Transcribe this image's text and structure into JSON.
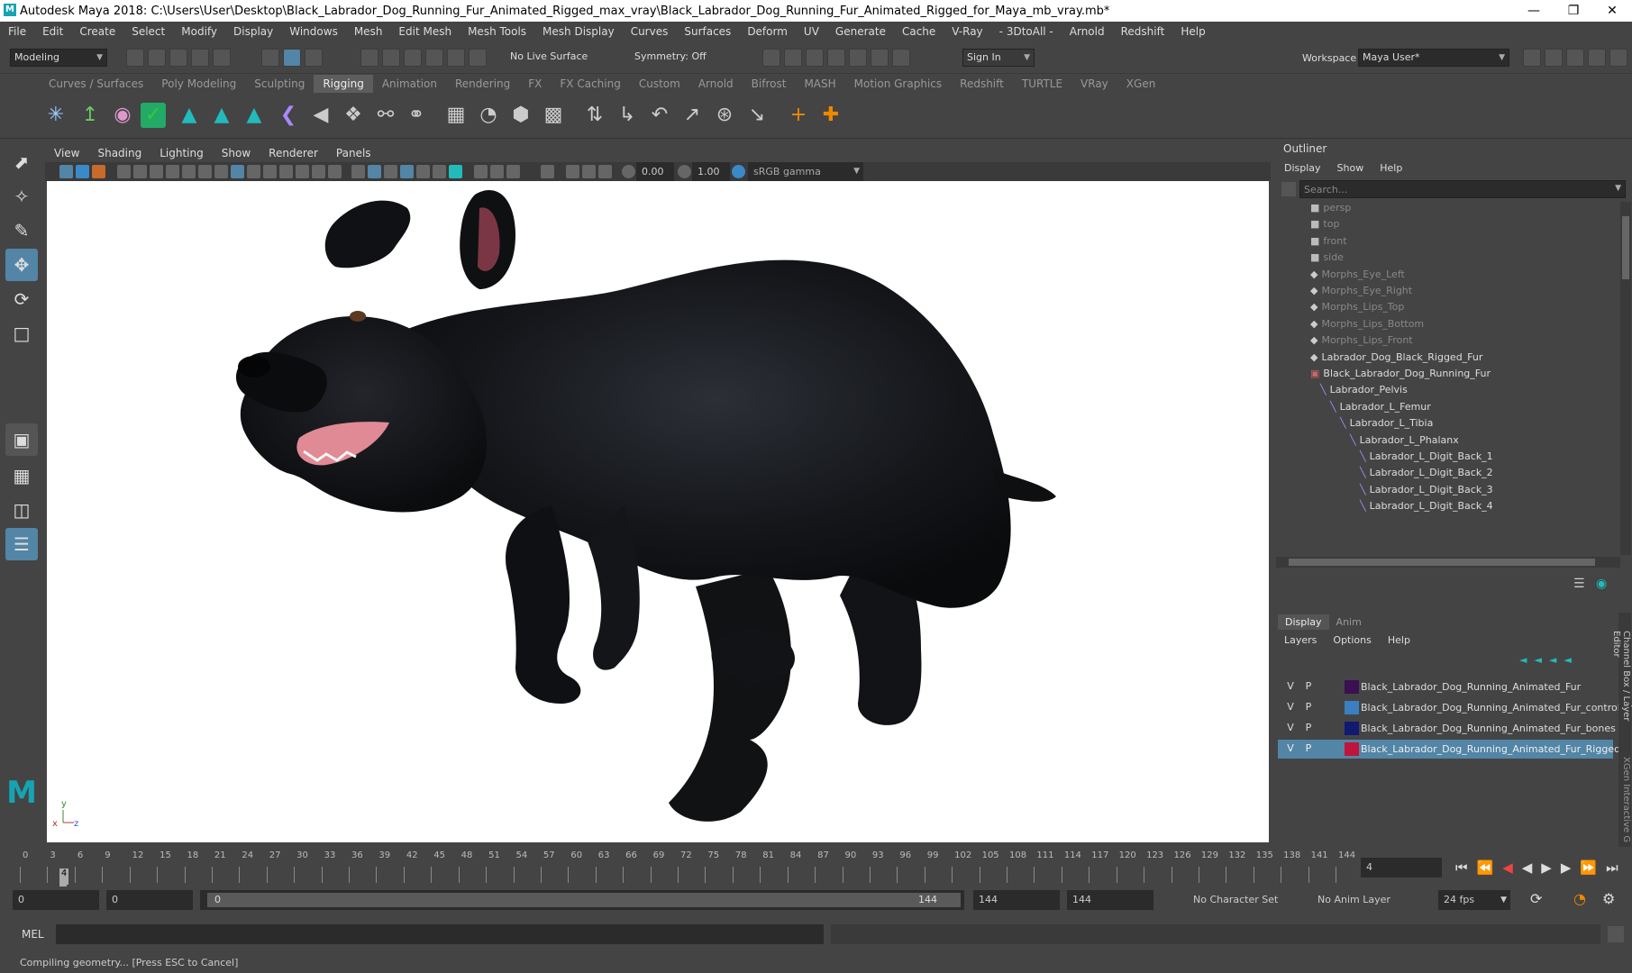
{
  "app": {
    "title": "Autodesk Maya 2018: C:\\Users\\User\\Desktop\\Black_Labrador_Dog_Running_Fur_Animated_Rigged_max_vray\\Black_Labrador_Dog_Running_Fur_Animated_Rigged_for_Maya_mb_vray.mb*",
    "logo_letter": "M",
    "accent": "#5285a6"
  },
  "menus": [
    "File",
    "Edit",
    "Create",
    "Select",
    "Modify",
    "Display",
    "Windows",
    "Mesh",
    "Edit Mesh",
    "Mesh Tools",
    "Mesh Display",
    "Curves",
    "Surfaces",
    "Deform",
    "UV",
    "Generate",
    "Cache",
    "V-Ray",
    "- 3DtoAll -",
    "Arnold",
    "Redshift",
    "Help"
  ],
  "status": {
    "mode": "Modeling",
    "live_surface": "No Live Surface",
    "symmetry": "Symmetry: Off",
    "sign_in": "Sign In",
    "workspace_label": "Workspace :",
    "workspace_value": "Maya User*"
  },
  "shelf_tabs": [
    "Curves / Surfaces",
    "Poly Modeling",
    "Sculpting",
    "Rigging",
    "Animation",
    "Rendering",
    "FX",
    "FX Caching",
    "Custom",
    "Arnold",
    "Bifrost",
    "MASH",
    "Motion Graphics",
    "Redshift",
    "TURTLE",
    "VRay",
    "XGen"
  ],
  "shelf_active": "Rigging",
  "viewport": {
    "menus": [
      "View",
      "Shading",
      "Lighting",
      "Show",
      "Renderer",
      "Panels"
    ],
    "exposure": "0.00",
    "gamma": "1.00",
    "color_space": "sRGB gamma",
    "axis_y": "y",
    "axis_x": "x",
    "axis_z": "z"
  },
  "outliner": {
    "title": "Outliner",
    "menus": [
      "Display",
      "Show",
      "Help"
    ],
    "search_placeholder": "Search...",
    "items": [
      {
        "label": "persp",
        "kind": "camera",
        "dim": true
      },
      {
        "label": "top",
        "kind": "camera",
        "dim": true
      },
      {
        "label": "front",
        "kind": "camera",
        "dim": true
      },
      {
        "label": "side",
        "kind": "camera",
        "dim": true
      },
      {
        "label": "Morphs_Eye_Left",
        "kind": "mesh",
        "dim": true
      },
      {
        "label": "Morphs_Eye_Right",
        "kind": "mesh",
        "dim": true
      },
      {
        "label": "Morphs_Lips_Top",
        "kind": "mesh",
        "dim": true
      },
      {
        "label": "Morphs_Lips_Bottom",
        "kind": "mesh",
        "dim": true
      },
      {
        "label": "Morphs_Lips_Front",
        "kind": "mesh",
        "dim": true
      },
      {
        "label": "Labrador_Dog_Black_Rigged_Fur",
        "kind": "mesh",
        "dim": false
      },
      {
        "label": "Black_Labrador_Dog_Running_Fur",
        "kind": "group",
        "dim": false
      },
      {
        "label": "Labrador_Pelvis",
        "kind": "joint",
        "dim": false
      },
      {
        "label": "Labrador_L_Femur",
        "kind": "joint",
        "dim": false
      },
      {
        "label": "Labrador_L_Tibia",
        "kind": "joint",
        "dim": false
      },
      {
        "label": "Labrador_L_Phalanx",
        "kind": "joint",
        "dim": false
      },
      {
        "label": "Labrador_L_Digit_Back_1",
        "kind": "joint",
        "dim": false
      },
      {
        "label": "Labrador_L_Digit_Back_2",
        "kind": "joint",
        "dim": false
      },
      {
        "label": "Labrador_L_Digit_Back_3",
        "kind": "joint",
        "dim": false
      },
      {
        "label": "Labrador_L_Digit_Back_4",
        "kind": "joint",
        "dim": false
      }
    ]
  },
  "layer_editor": {
    "tabs": [
      "Display",
      "Anim"
    ],
    "menus": [
      "Layers",
      "Options",
      "Help"
    ],
    "side_label": "Channel Box / Layer Editor",
    "side_label2": "XGen Interactive G",
    "layers": [
      {
        "v": "V",
        "p": "P",
        "color": "#3a1050",
        "name": "Black_Labrador_Dog_Running_Animated_Fur",
        "selected": false
      },
      {
        "v": "V",
        "p": "P",
        "color": "#3a7fc0",
        "name": "Black_Labrador_Dog_Running_Animated_Fur_controllers",
        "selected": false
      },
      {
        "v": "V",
        "p": "P",
        "color": "#101a70",
        "name": "Black_Labrador_Dog_Running_Animated_Fur_bones",
        "selected": false
      },
      {
        "v": "V",
        "p": "P",
        "color": "#c0143c",
        "name": "Black_Labrador_Dog_Running_Animated_Fur_Rigged",
        "selected": true
      }
    ]
  },
  "timeline": {
    "ticks": [
      "0",
      "3",
      "6",
      "9",
      "12",
      "15",
      "18",
      "21",
      "24",
      "27",
      "30",
      "33",
      "36",
      "39",
      "42",
      "45",
      "48",
      "51",
      "54",
      "57",
      "60",
      "63",
      "66",
      "69",
      "72",
      "75",
      "78",
      "81",
      "84",
      "87",
      "90",
      "93",
      "96",
      "99",
      "102",
      "105",
      "108",
      "111",
      "114",
      "117",
      "120",
      "123",
      "126",
      "129",
      "132",
      "135",
      "138",
      "141",
      "144"
    ],
    "current_frame": "4",
    "current_field": "4"
  },
  "range": {
    "start": "0",
    "playback_start": "0",
    "range_left": "0",
    "range_right": "144",
    "playback_end": "144",
    "end": "144",
    "character_set": "No Character Set",
    "anim_layer": "No Anim Layer",
    "fps": "24 fps"
  },
  "command": {
    "label": "MEL"
  },
  "help_line": "Compiling geometry... [Press ESC to Cancel]"
}
